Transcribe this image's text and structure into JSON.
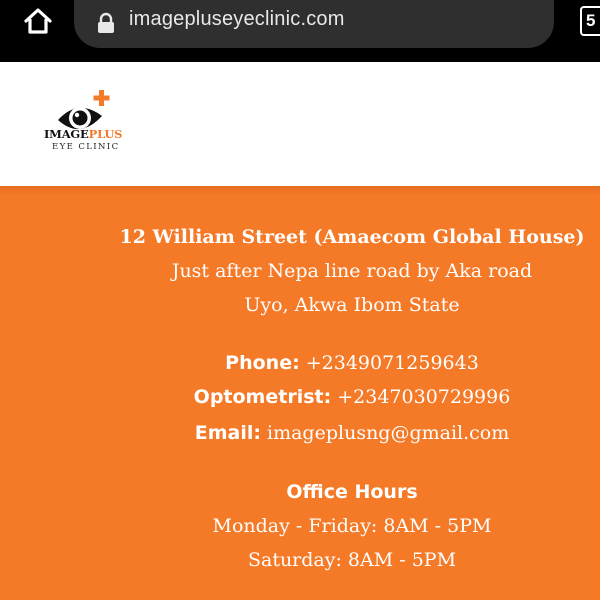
{
  "browser": {
    "url": "imagepluseyeclinic.com",
    "tab_count": "5"
  },
  "logo": {
    "name_part1": "IMAGE",
    "name_part2": "PLUS",
    "subtitle": "EYE CLINIC"
  },
  "address": {
    "line1": "12 William Street (Amaecom Global House)",
    "line2": "Just after Nepa line road by Aka road",
    "line3": "Uyo, Akwa Ibom State"
  },
  "contacts": {
    "phone_label": "Phone:",
    "phone_value": "+2349071259643",
    "optometrist_label": "Optometrist:",
    "optometrist_value": "+2347030729996",
    "email_label": "Email:",
    "email_value": "imageplusng@gmail.com"
  },
  "office_hours": {
    "title": "Office Hours",
    "weekdays": "Monday - Friday: 8AM - 5PM",
    "saturday": "Saturday: 8AM - 5PM"
  },
  "colors": {
    "brand_orange": "#f47a28",
    "browser_bar": "#000000",
    "url_field": "#2f2f2f"
  },
  "icons": [
    "home-icon",
    "lock-icon",
    "tab-switcher-icon",
    "eye-plus-logo-icon"
  ]
}
